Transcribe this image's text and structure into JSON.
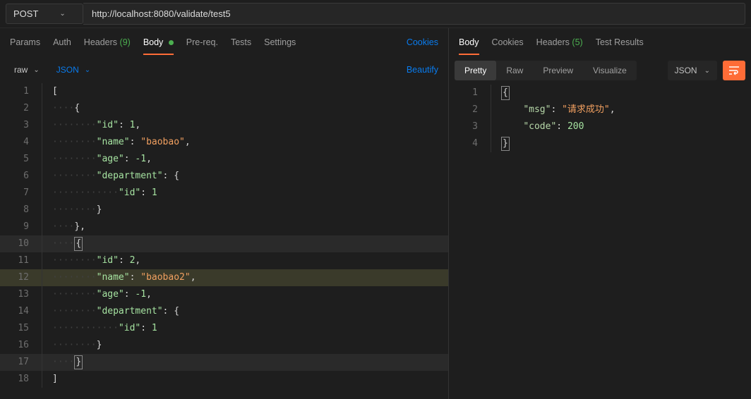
{
  "request": {
    "method": "POST",
    "url": "http://localhost:8080/validate/test5"
  },
  "req_tabs": {
    "params": "Params",
    "auth": "Auth",
    "headers": "Headers",
    "headers_count": "(9)",
    "body": "Body",
    "prereq": "Pre-req.",
    "tests": "Tests",
    "settings": "Settings",
    "cookies": "Cookies"
  },
  "req_subbar": {
    "raw": "raw",
    "json": "JSON",
    "beautify": "Beautify"
  },
  "request_body": {
    "lines": [
      {
        "n": 1,
        "indent": "",
        "segs": [
          {
            "t": "punc",
            "v": "["
          }
        ]
      },
      {
        "n": 2,
        "indent": "····",
        "segs": [
          {
            "t": "punc",
            "v": "{"
          }
        ]
      },
      {
        "n": 3,
        "indent": "········",
        "segs": [
          {
            "t": "key",
            "v": "\"id\""
          },
          {
            "t": "punc",
            "v": ": "
          },
          {
            "t": "num",
            "v": "1"
          },
          {
            "t": "punc",
            "v": ","
          }
        ]
      },
      {
        "n": 4,
        "indent": "········",
        "segs": [
          {
            "t": "key",
            "v": "\"name\""
          },
          {
            "t": "punc",
            "v": ": "
          },
          {
            "t": "str",
            "v": "\"baobao\""
          },
          {
            "t": "punc",
            "v": ","
          }
        ]
      },
      {
        "n": 5,
        "indent": "········",
        "segs": [
          {
            "t": "key",
            "v": "\"age\""
          },
          {
            "t": "punc",
            "v": ": "
          },
          {
            "t": "num",
            "v": "-1"
          },
          {
            "t": "punc",
            "v": ","
          }
        ]
      },
      {
        "n": 6,
        "indent": "········",
        "segs": [
          {
            "t": "key",
            "v": "\"department\""
          },
          {
            "t": "punc",
            "v": ": {"
          }
        ]
      },
      {
        "n": 7,
        "indent": "············",
        "segs": [
          {
            "t": "key",
            "v": "\"id\""
          },
          {
            "t": "punc",
            "v": ": "
          },
          {
            "t": "num",
            "v": "1"
          }
        ]
      },
      {
        "n": 8,
        "indent": "········",
        "segs": [
          {
            "t": "punc",
            "v": "}"
          }
        ]
      },
      {
        "n": 9,
        "indent": "····",
        "segs": [
          {
            "t": "punc",
            "v": "},"
          }
        ]
      },
      {
        "n": 10,
        "indent": "····",
        "segs": [
          {
            "t": "cursor",
            "v": "{"
          }
        ],
        "hl2": true
      },
      {
        "n": 11,
        "indent": "········",
        "segs": [
          {
            "t": "key",
            "v": "\"id\""
          },
          {
            "t": "punc",
            "v": ": "
          },
          {
            "t": "num",
            "v": "2"
          },
          {
            "t": "punc",
            "v": ","
          }
        ]
      },
      {
        "n": 12,
        "indent": "········",
        "segs": [
          {
            "t": "key",
            "v": "\"name\""
          },
          {
            "t": "punc",
            "v": ": "
          },
          {
            "t": "str",
            "v": "\"baobao2\""
          },
          {
            "t": "punc",
            "v": ","
          }
        ],
        "hl": true
      },
      {
        "n": 13,
        "indent": "········",
        "segs": [
          {
            "t": "key",
            "v": "\"age\""
          },
          {
            "t": "punc",
            "v": ": "
          },
          {
            "t": "num",
            "v": "-1"
          },
          {
            "t": "punc",
            "v": ","
          }
        ]
      },
      {
        "n": 14,
        "indent": "········",
        "segs": [
          {
            "t": "key",
            "v": "\"department\""
          },
          {
            "t": "punc",
            "v": ": {"
          }
        ]
      },
      {
        "n": 15,
        "indent": "············",
        "segs": [
          {
            "t": "key",
            "v": "\"id\""
          },
          {
            "t": "punc",
            "v": ": "
          },
          {
            "t": "num",
            "v": "1"
          }
        ]
      },
      {
        "n": 16,
        "indent": "········",
        "segs": [
          {
            "t": "punc",
            "v": "}"
          }
        ]
      },
      {
        "n": 17,
        "indent": "····",
        "segs": [
          {
            "t": "cursor",
            "v": "}"
          }
        ],
        "hl2": true
      },
      {
        "n": 18,
        "indent": "",
        "segs": [
          {
            "t": "punc",
            "v": "]"
          }
        ]
      }
    ]
  },
  "resp_tabs": {
    "body": "Body",
    "cookies": "Cookies",
    "headers": "Headers",
    "headers_count": "(5)",
    "test_results": "Test Results"
  },
  "resp_subbar": {
    "pretty": "Pretty",
    "raw": "Raw",
    "preview": "Preview",
    "visualize": "Visualize",
    "json": "JSON"
  },
  "response_body": {
    "lines": [
      {
        "n": 1,
        "indent": "",
        "segs": [
          {
            "t": "cursor",
            "v": "{"
          }
        ]
      },
      {
        "n": 2,
        "indent": "    ",
        "segs": [
          {
            "t": "resp-key",
            "v": "\"msg\""
          },
          {
            "t": "punc",
            "v": ": "
          },
          {
            "t": "resp-str",
            "v": "\"请求成功\""
          },
          {
            "t": "punc",
            "v": ","
          }
        ]
      },
      {
        "n": 3,
        "indent": "    ",
        "segs": [
          {
            "t": "resp-key",
            "v": "\"code\""
          },
          {
            "t": "punc",
            "v": ": "
          },
          {
            "t": "resp-num",
            "v": "200"
          }
        ]
      },
      {
        "n": 4,
        "indent": "",
        "segs": [
          {
            "t": "cursor",
            "v": "}"
          }
        ]
      }
    ]
  }
}
